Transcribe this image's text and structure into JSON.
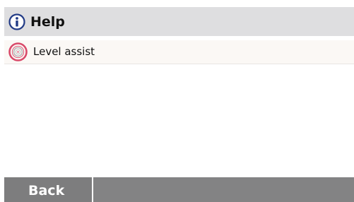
{
  "header": {
    "title": "Help",
    "icon": "info-icon"
  },
  "list": {
    "items": [
      {
        "label": "Level assist",
        "icon": "level-target-icon"
      }
    ]
  },
  "footer": {
    "back_label": "Back"
  },
  "colors": {
    "header_bg": "#dedee0",
    "info_icon": "#223b86",
    "target_icon": "#d94a6a",
    "footer_bg": "#838384"
  }
}
